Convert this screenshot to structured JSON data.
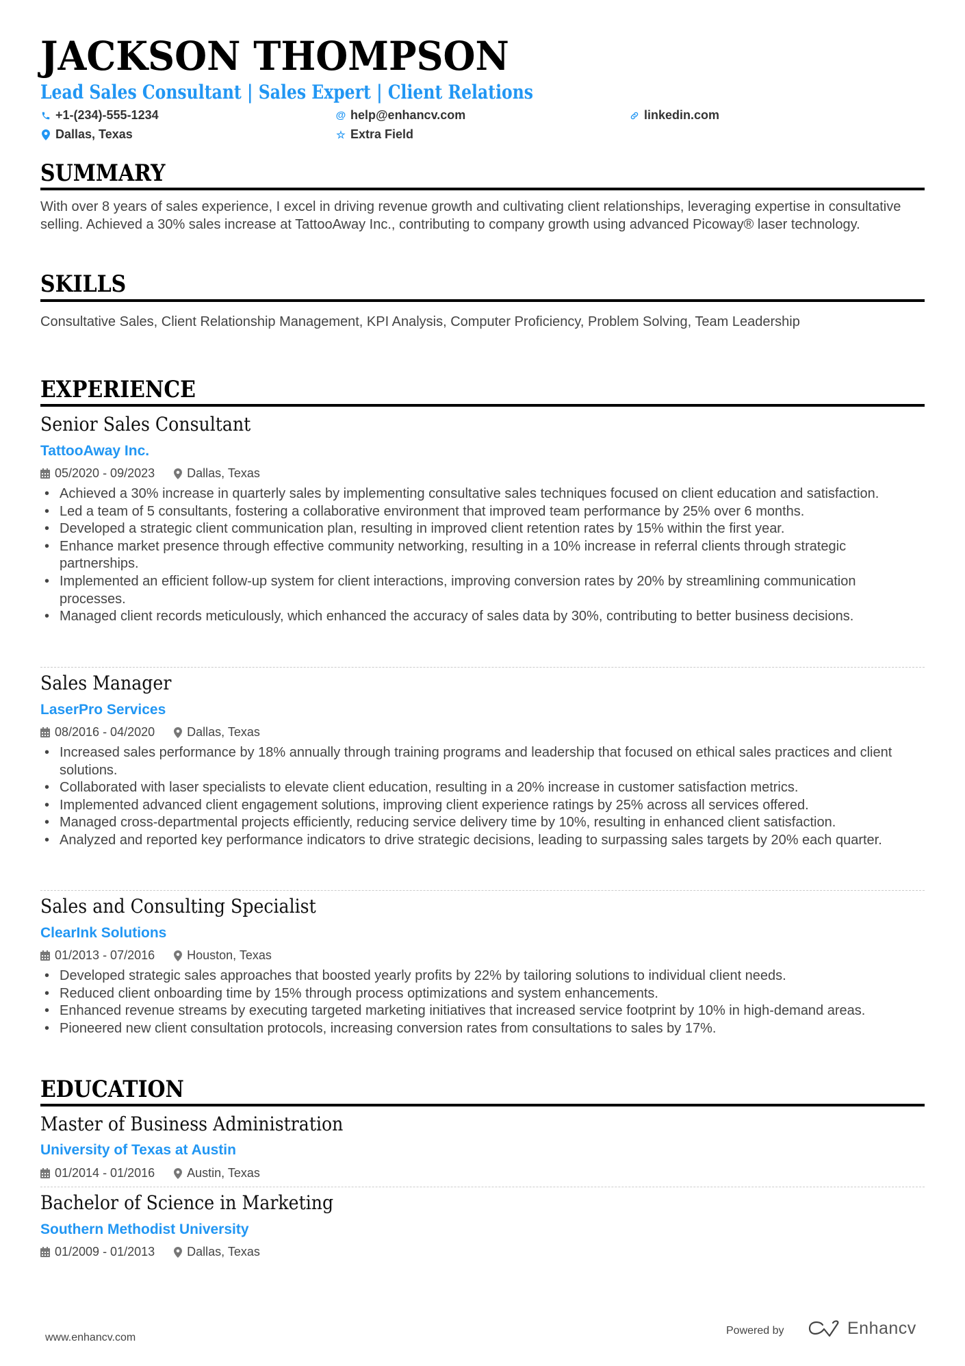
{
  "header": {
    "name": "JACKSON THOMPSON",
    "subtitle": "Lead Sales Consultant | Sales Expert | Client Relations",
    "contacts": {
      "phone": {
        "icon": "phone-icon",
        "value": "+1-(234)-555-1234"
      },
      "email": {
        "icon": "at-icon",
        "value": "help@enhancv.com"
      },
      "linkedin": {
        "icon": "link-icon",
        "value": "linkedin.com"
      },
      "location": {
        "icon": "map-pin-icon",
        "value": "Dallas, Texas"
      },
      "extra": {
        "icon": "star-icon",
        "value": "Extra Field"
      }
    }
  },
  "summary": {
    "heading": "SUMMARY",
    "text": "With over 8 years of sales experience, I excel in driving revenue growth and cultivating client relationships, leveraging expertise in consultative selling. Achieved a 30% sales increase at TattooAway Inc., contributing to company growth using advanced Picoway® laser technology."
  },
  "skills": {
    "heading": "SKILLS",
    "text": "Consultative Sales, Client Relationship Management, KPI Analysis, Computer Proficiency, Problem Solving, Team Leadership"
  },
  "experience": {
    "heading": "EXPERIENCE",
    "jobs": [
      {
        "title": "Senior Sales Consultant",
        "company": "TattooAway Inc.",
        "dates": "05/2020 - 09/2023",
        "location": "Dallas, Texas",
        "bullets": [
          "Achieved a 30% increase in quarterly sales by implementing consultative sales techniques focused on client education and satisfaction.",
          "Led a team of 5 consultants, fostering a collaborative environment that improved team performance by 25% over 6 months.",
          "Developed a strategic client communication plan, resulting in improved client retention rates by 15% within the first year.",
          "Enhance market presence through effective community networking, resulting in a 10% increase in referral clients through strategic partnerships.",
          "Implemented an efficient follow-up system for client interactions, improving conversion rates by 20% by streamlining communication processes.",
          "Managed client records meticulously, which enhanced the accuracy of sales data by 30%, contributing to better business decisions."
        ]
      },
      {
        "title": "Sales Manager",
        "company": "LaserPro Services",
        "dates": "08/2016 - 04/2020",
        "location": "Dallas, Texas",
        "bullets": [
          "Increased sales performance by 18% annually through training programs and leadership that focused on ethical sales practices and client solutions.",
          "Collaborated with laser specialists to elevate client education, resulting in a 20% increase in customer satisfaction metrics.",
          "Implemented advanced client engagement solutions, improving client experience ratings by 25% across all services offered.",
          "Managed cross-departmental projects efficiently, reducing service delivery time by 10%, resulting in enhanced client satisfaction.",
          "Analyzed and reported key performance indicators to drive strategic decisions, leading to surpassing sales targets by 20% each quarter."
        ]
      },
      {
        "title": "Sales and Consulting Specialist",
        "company": "ClearInk Solutions",
        "dates": "01/2013 - 07/2016",
        "location": "Houston, Texas",
        "bullets": [
          "Developed strategic sales approaches that boosted yearly profits by 22% by tailoring solutions to individual client needs.",
          "Reduced client onboarding time by 15% through process optimizations and system enhancements.",
          "Enhanced revenue streams by executing targeted marketing initiatives that increased service footprint by 10% in high-demand areas.",
          "Pioneered new client consultation protocols, increasing conversion rates from consultations to sales by 17%."
        ]
      }
    ]
  },
  "education": {
    "heading": "EDUCATION",
    "items": [
      {
        "degree": "Master of Business Administration",
        "school": "University of Texas at Austin",
        "dates": "01/2014 - 01/2016",
        "location": "Austin, Texas"
      },
      {
        "degree": "Bachelor of Science in Marketing",
        "school": "Southern Methodist University",
        "dates": "01/2009 - 01/2013",
        "location": "Dallas, Texas"
      }
    ]
  },
  "footer": {
    "url": "www.enhancv.com",
    "powered_by": "Powered by",
    "brand": "Enhancv"
  },
  "colors": {
    "accent": "#2196f3",
    "text": "#333333",
    "heading": "#000000"
  }
}
